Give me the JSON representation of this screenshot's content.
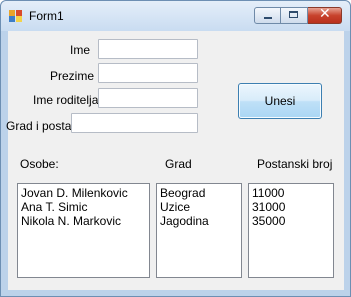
{
  "window": {
    "title": "Form1",
    "minimize_glyph": "",
    "close_glyph": "✕"
  },
  "form": {
    "labels": {
      "ime": "Ime",
      "prezime": "Prezime",
      "ime_roditelja": "Ime roditelja",
      "grad_postanski": "Grad i postanski br."
    },
    "fields": {
      "ime": "",
      "prezime": "",
      "ime_roditelja": "",
      "grad_postanski": ""
    },
    "submit_label": "Unesi"
  },
  "lists": {
    "osobe_label": "Osobe:",
    "grad_label": "Grad",
    "postanski_label": "Postanski broj",
    "osobe": [
      "Jovan D. Milenkovic",
      "Ana T. Simic",
      "Nikola N. Markovic"
    ],
    "gradovi": [
      "Beograd",
      "Uzice",
      "Jagodina"
    ],
    "postanski": [
      "11000",
      "31000",
      "35000"
    ]
  }
}
